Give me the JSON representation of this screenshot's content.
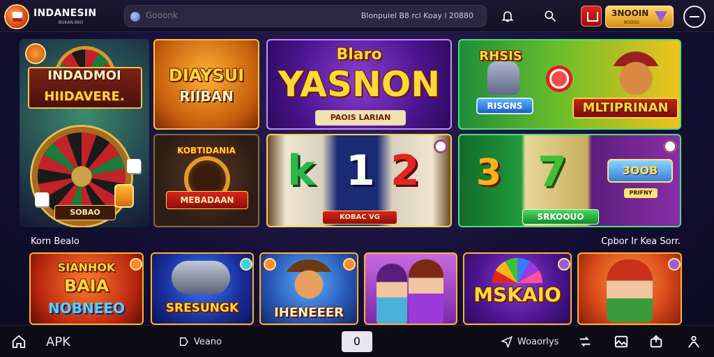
{
  "header": {
    "brand": "INDANESIN",
    "brand_sub": "BUKAN BKO",
    "search_placeholder": "Gooonk",
    "promo_text": "Blonpuiel B8 rcl Koay l 20880",
    "coin_label": "3NOOIN",
    "coin_sub": "BOOOS"
  },
  "tiles": {
    "hero": {
      "title1": "INDADMOI",
      "title2": "HIIDAVERE.",
      "ribbon": "SOBAO"
    },
    "t1": {
      "title": "DIAYSUI",
      "sub": "RIIBAN"
    },
    "t2": {
      "top": "Blaro",
      "title": "YASNON",
      "sub": "PAOIS LARIAN"
    },
    "t3": {
      "left": "RHSIS",
      "pill": "RISGNS",
      "title": "MLTIPRINAN"
    },
    "t4": {
      "title": "KOBTIDANIA",
      "ribbon": "MEBADAAN"
    },
    "t5": {
      "n1": "k",
      "n2": "1",
      "n3": "2",
      "ribbon": "KOBAC VG"
    },
    "t6": {
      "n1": "3",
      "n2": "7",
      "badge": "3OOB",
      "small": "PRIFNY",
      "ribbon": "SRKOOUO"
    }
  },
  "section": {
    "left": "Korn Bealo",
    "right": "Cpbor Ir Kea Sorr."
  },
  "bottom_tiles": [
    {
      "line1": "SIANHOK",
      "line2": "BAIA",
      "line3": "NOBNEEO"
    },
    {
      "line1": "SRESUNGK"
    },
    {
      "line1": "IHENEEER"
    },
    {
      "line1": ""
    },
    {
      "line1": "MSKAIO"
    },
    {
      "line1": ""
    }
  ],
  "nav": {
    "apk": "APK",
    "veano": "Veano",
    "center": "O",
    "whatsup": "Woaorlys"
  }
}
